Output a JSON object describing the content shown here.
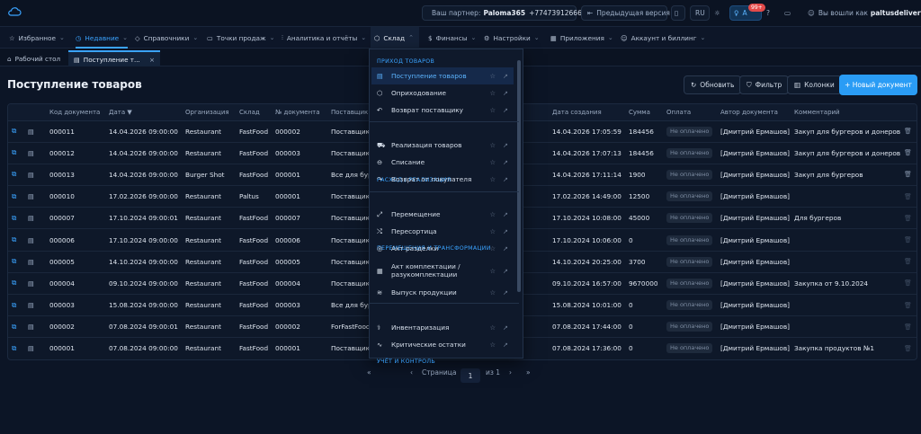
{
  "topbar": {
    "partner_label": "Ваш партнер:",
    "partner_name": "Paloma365",
    "partner_phone": "+77473912666",
    "prev_version": "Предыдущая версия",
    "lang": "RU",
    "notif_count": "99+",
    "user_prefix": "Вы вошли как",
    "user_name": "paltusdelivery"
  },
  "nav": [
    {
      "label": "Избранное",
      "icon": "star-icon"
    },
    {
      "label": "Недавние",
      "icon": "clock-icon"
    },
    {
      "label": "Справочники",
      "icon": "tag-icon"
    },
    {
      "label": "Точки продаж",
      "icon": "monitor-icon"
    },
    {
      "label": "Аналитика и отчёты",
      "icon": "chart-icon"
    },
    {
      "label": "Склад",
      "icon": "box-icon"
    },
    {
      "label": "Финансы",
      "icon": "money-icon"
    },
    {
      "label": "Настройки",
      "icon": "gear-icon"
    },
    {
      "label": "Приложения",
      "icon": "grid-icon"
    },
    {
      "label": "Аккаунт и биллинг",
      "icon": "user-icon"
    }
  ],
  "tabs": {
    "desktop": "Рабочий стол",
    "current": "Поступление т..."
  },
  "page": {
    "title": "Поступление товаров",
    "refresh": "Обновить",
    "filter": "Фильтр",
    "columns": "Колонки",
    "new_doc": "+ Новый документ"
  },
  "table": {
    "headers": [
      "",
      "",
      "Код документа",
      "Дата ▼",
      "Организация",
      "Склад",
      "№ документа",
      "Поставщик",
      "",
      "Дата создания",
      "Сумма",
      "Оплата",
      "Автор документа",
      "Комментарий",
      ""
    ],
    "rows": [
      [
        "000011",
        "14.04.2026 09:00:00",
        "Restaurant",
        "FastFood",
        "000002",
        "Поставщик",
        "14.04.2026 17:05:59",
        "184456",
        "Не оплачено",
        "[Дмитрий Ермашов]",
        "Закуп для бургеров и донеров"
      ],
      [
        "000012",
        "14.04.2026 09:00:00",
        "Restaurant",
        "FastFood",
        "000003",
        "Поставщик",
        "14.04.2026 17:07:13",
        "184456",
        "Не оплачено",
        "[Дмитрий Ермашов]",
        "Закуп для бургеров и донеров"
      ],
      [
        "000013",
        "14.04.2026 09:00:00",
        "Burger Shot",
        "FastFood",
        "000001",
        "Все для бургеров",
        "14.04.2026 17:11:14",
        "1900",
        "Не оплачено",
        "[Дмитрий Ермашов]",
        "Закуп для бургеров"
      ],
      [
        "000010",
        "17.02.2026 09:00:00",
        "Restaurant",
        "Paltus",
        "000001",
        "Поставщик",
        "17.02.2026 14:49:00",
        "12500",
        "Не оплачено",
        "[Дмитрий Ермашов]",
        ""
      ],
      [
        "000007",
        "17.10.2024 09:00:01",
        "Restaurant",
        "FastFood",
        "000007",
        "Поставщик",
        "17.10.2024 10:08:00",
        "45000",
        "Не оплачено",
        "[Дмитрий Ермашов]",
        "Для бургеров"
      ],
      [
        "000006",
        "17.10.2024 09:00:00",
        "Restaurant",
        "FastFood",
        "000006",
        "Поставщик",
        "17.10.2024 10:06:00",
        "0",
        "Не оплачено",
        "[Дмитрий Ермашов]",
        ""
      ],
      [
        "000005",
        "14.10.2024 09:00:00",
        "Restaurant",
        "FastFood",
        "000005",
        "Поставщик",
        "14.10.2024 20:25:00",
        "3700",
        "Не оплачено",
        "[Дмитрий Ермашов]",
        ""
      ],
      [
        "000004",
        "09.10.2024 09:00:00",
        "Restaurant",
        "FastFood",
        "000004",
        "Поставщик",
        "09.10.2024 16:57:00",
        "9670000",
        "Не оплачено",
        "[Дмитрий Ермашов]",
        "Закупка от 9.10.2024"
      ],
      [
        "000003",
        "15.08.2024 09:00:00",
        "Restaurant",
        "FastFood",
        "000003",
        "Все для бургеров",
        "15.08.2024 10:01:00",
        "0",
        "Не оплачено",
        "[Дмитрий Ермашов]",
        ""
      ],
      [
        "000002",
        "07.08.2024 09:00:01",
        "Restaurant",
        "FastFood",
        "000002",
        "ForFastFood",
        "07.08.2024 17:44:00",
        "0",
        "Не оплачено",
        "[Дмитрий Ермашов]",
        ""
      ],
      [
        "000001",
        "07.08.2024 09:00:00",
        "Restaurant",
        "FastFood",
        "000001",
        "Поставщик",
        "07.08.2024 17:36:00",
        "0",
        "Не оплачено",
        "[Дмитрий Ермашов]",
        "Закупка продуктов №1"
      ]
    ]
  },
  "dropdown": {
    "sections": [
      {
        "title": "ПРИХОД ТОВАРОВ",
        "items": [
          "Поступление товаров",
          "Оприходование",
          "Возврат поставщику"
        ]
      },
      {
        "title": "РАСХОД / РЕАЛИЗАЦИЯ",
        "items": [
          "Реализация товаров",
          "Списание",
          "Возврат от покупателя"
        ]
      },
      {
        "title": "ПЕРЕМЕЩЕНИЯ И ТРАНСФОРМАЦИИ",
        "items": [
          "Перемещение",
          "Пересортица",
          "Акт разделки",
          "Акт комплектации / разукомплектации",
          "Выпуск продукции"
        ]
      },
      {
        "title": "УЧЁТ И КОНТРОЛЬ",
        "items": [
          "Инвентаризация",
          "Критические остатки"
        ]
      }
    ]
  },
  "pager": {
    "label": "Страница",
    "page": "1",
    "of": "из 1"
  }
}
